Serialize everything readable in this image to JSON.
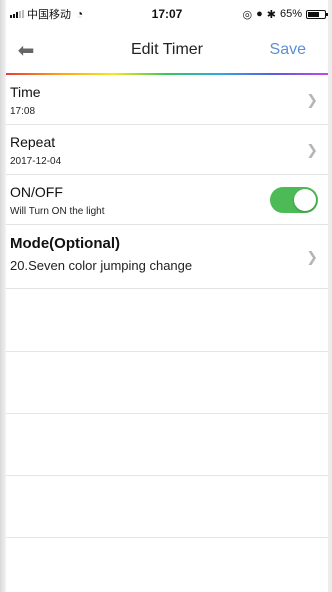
{
  "status_bar": {
    "carrier": "中国移动",
    "time": "17:07",
    "battery": "65%"
  },
  "nav": {
    "title": "Edit Timer",
    "save_label": "Save",
    "back_icon": "back-arrow-icon"
  },
  "rows": [
    {
      "title": "Time",
      "subtitle": "17:08"
    },
    {
      "title": "Repeat",
      "subtitle": "2017-12-04"
    },
    {
      "title": "ON/OFF",
      "subtitle": "Will Turn ON the light",
      "toggle_on": true
    },
    {
      "title": "Mode(Optional)",
      "subtitle": "20.Seven color jumping change"
    }
  ],
  "colors": {
    "accent": "#5b8fd8",
    "toggle_on": "#4cba55"
  }
}
